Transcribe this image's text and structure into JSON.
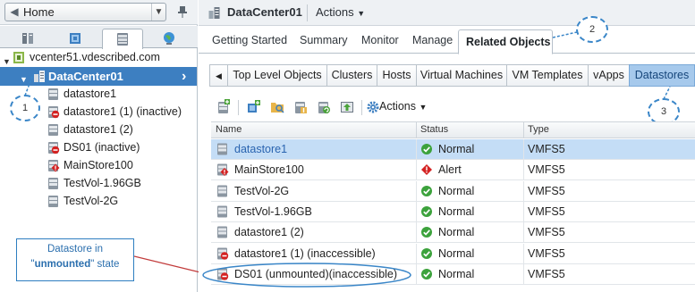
{
  "left_panel": {
    "home_label": "Home",
    "tree": {
      "vcenter": "vcenter51.vdescribed.com",
      "datacenter": "DataCenter01",
      "datastores": [
        {
          "label": "datastore1",
          "state": "normal"
        },
        {
          "label": "datastore1 (1) (inactive)",
          "state": "inactive"
        },
        {
          "label": "datastore1 (2)",
          "state": "normal"
        },
        {
          "label": "DS01 (inactive)",
          "state": "inactive"
        },
        {
          "label": "MainStore100",
          "state": "alert"
        },
        {
          "label": "TestVol-1.96GB",
          "state": "normal"
        },
        {
          "label": "TestVol-2G",
          "state": "normal"
        }
      ]
    },
    "callout_1": "1",
    "note": {
      "line1": "Datastore in",
      "quote_open": "\"",
      "emphasis": "unmounted",
      "quote_close": "\"",
      "suffix": " state"
    }
  },
  "right_panel": {
    "title": "DataCenter01",
    "actions_label": "Actions",
    "main_tabs": [
      "Getting Started",
      "Summary",
      "Monitor",
      "Manage",
      "Related Objects"
    ],
    "sub_tabs": [
      "Top Level Objects",
      "Clusters",
      "Hosts",
      "Virtual Machines",
      "VM Templates",
      "vApps",
      "Datastores"
    ],
    "toolbar_actions": "Actions",
    "callout_2": "2",
    "callout_3": "3",
    "table": {
      "headers": [
        "Name",
        "Status",
        "Type"
      ],
      "rows": [
        {
          "name": "datastore1",
          "status": "Normal",
          "type": "VMFS5",
          "selected": true,
          "icon": "datastore-icon"
        },
        {
          "name": "MainStore100",
          "status": "Alert",
          "type": "VMFS5",
          "selected": false,
          "icon": "datastore-alert-icon"
        },
        {
          "name": "TestVol-2G",
          "status": "Normal",
          "type": "VMFS5",
          "selected": false,
          "icon": "datastore-icon"
        },
        {
          "name": "TestVol-1.96GB",
          "status": "Normal",
          "type": "VMFS5",
          "selected": false,
          "icon": "datastore-icon"
        },
        {
          "name": "datastore1 (2)",
          "status": "Normal",
          "type": "VMFS5",
          "selected": false,
          "icon": "datastore-icon"
        },
        {
          "name": "datastore1 (1) (inaccessible)",
          "status": "Normal",
          "type": "VMFS5",
          "selected": false,
          "icon": "datastore-inactive-icon"
        },
        {
          "name": "DS01 (unmounted)(inaccessible)",
          "status": "Normal",
          "type": "VMFS5",
          "selected": false,
          "icon": "datastore-inactive-icon"
        }
      ]
    }
  },
  "colors": {
    "accent": "#3d7fc1",
    "selected_row": "#c4ddf6",
    "active_subtab": "#a6c9ec",
    "annotation": "#3a86c8"
  }
}
